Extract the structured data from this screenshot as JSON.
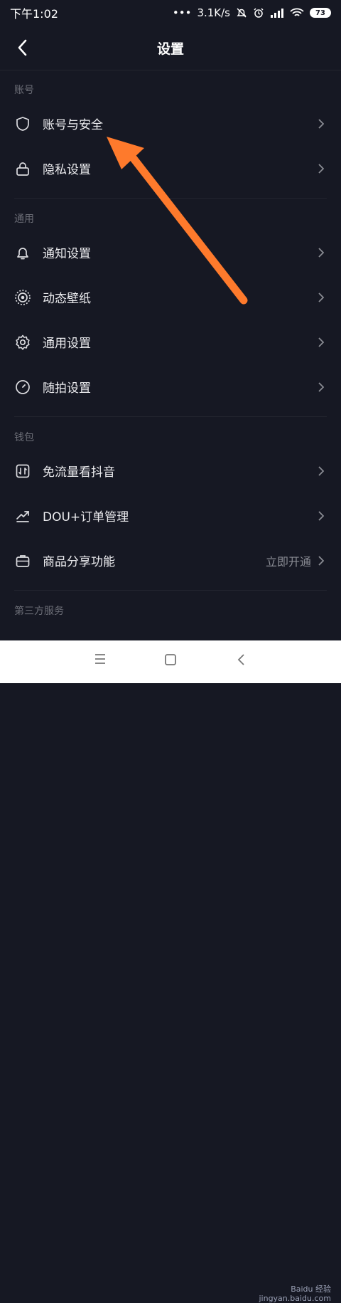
{
  "status_bar": {
    "time": "下午1:02",
    "dots": "•••",
    "speed": "3.1K/s",
    "battery": "73"
  },
  "header": {
    "title": "设置"
  },
  "sections": [
    {
      "title": "账号",
      "items": [
        {
          "label": "账号与安全",
          "icon": "shield-icon"
        },
        {
          "label": "隐私设置",
          "icon": "lock-icon"
        }
      ]
    },
    {
      "title": "通用",
      "items": [
        {
          "label": "通知设置",
          "icon": "bell-icon"
        },
        {
          "label": "动态壁纸",
          "icon": "live-wallpaper-icon"
        },
        {
          "label": "通用设置",
          "icon": "gear-icon"
        },
        {
          "label": "随拍设置",
          "icon": "clock-icon"
        }
      ]
    },
    {
      "title": "钱包",
      "items": [
        {
          "label": "免流量看抖音",
          "icon": "data-free-icon"
        },
        {
          "label": "DOU+订单管理",
          "icon": "trend-icon"
        },
        {
          "label": "商品分享功能",
          "icon": "briefcase-icon",
          "extra": "立即开通"
        }
      ]
    },
    {
      "title": "第三方服务",
      "items": []
    }
  ],
  "watermark": {
    "line1": "Baidu 经验",
    "line2": "jingyan.baidu.com"
  },
  "colors": {
    "background": "#161823",
    "arrow": "#fe7a2c"
  }
}
